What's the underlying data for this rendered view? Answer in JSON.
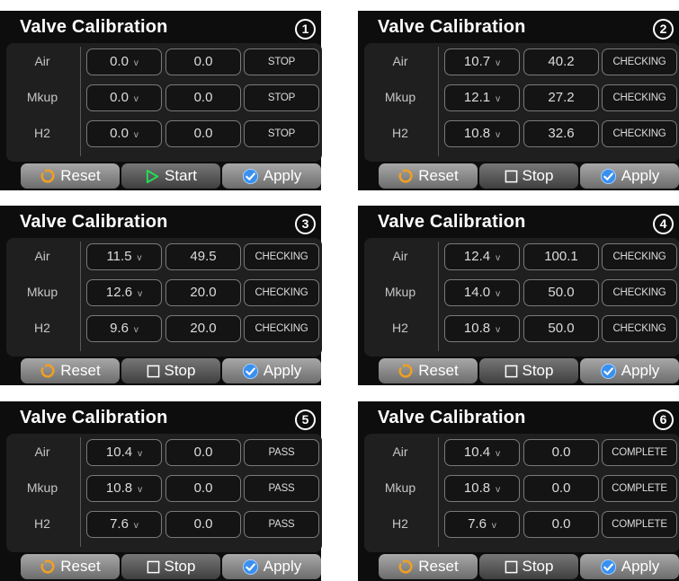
{
  "units": {
    "voltage": "v"
  },
  "icons": {
    "reset": "circular-arrow-icon",
    "start": "play-triangle-icon",
    "stop": "stop-square-icon",
    "apply": "checkmark-circle-icon"
  },
  "colors": {
    "reset_icon": "#f0a020",
    "start_icon": "#22e055",
    "apply_icon": "#3a90ee"
  },
  "row_labels": [
    "Air",
    "Mkup",
    "H2"
  ],
  "panels": [
    {
      "title": "Valve Calibration",
      "number": "1",
      "rows": [
        {
          "label": "Air",
          "voltage": "0.0",
          "value": "0.0",
          "status": "STOP"
        },
        {
          "label": "Mkup",
          "voltage": "0.0",
          "value": "0.0",
          "status": "STOP"
        },
        {
          "label": "H2",
          "voltage": "0.0",
          "value": "0.0",
          "status": "STOP"
        }
      ],
      "buttons": {
        "reset": "Reset",
        "middle": "Start",
        "apply": "Apply"
      }
    },
    {
      "title": "Valve Calibration",
      "number": "2",
      "rows": [
        {
          "label": "Air",
          "voltage": "10.7",
          "value": "40.2",
          "status": "CHECKING"
        },
        {
          "label": "Mkup",
          "voltage": "12.1",
          "value": "27.2",
          "status": "CHECKING"
        },
        {
          "label": "H2",
          "voltage": "10.8",
          "value": "32.6",
          "status": "CHECKING"
        }
      ],
      "buttons": {
        "reset": "Reset",
        "middle": "Stop",
        "apply": "Apply"
      }
    },
    {
      "title": "Valve Calibration",
      "number": "3",
      "rows": [
        {
          "label": "Air",
          "voltage": "11.5",
          "value": "49.5",
          "status": "CHECKING"
        },
        {
          "label": "Mkup",
          "voltage": "12.6",
          "value": "20.0",
          "status": "CHECKING"
        },
        {
          "label": "H2",
          "voltage": "9.6",
          "value": "20.0",
          "status": "CHECKING"
        }
      ],
      "buttons": {
        "reset": "Reset",
        "middle": "Stop",
        "apply": "Apply"
      }
    },
    {
      "title": "Valve Calibration",
      "number": "4",
      "rows": [
        {
          "label": "Air",
          "voltage": "12.4",
          "value": "100.1",
          "status": "CHECKING"
        },
        {
          "label": "Mkup",
          "voltage": "14.0",
          "value": "50.0",
          "status": "CHECKING"
        },
        {
          "label": "H2",
          "voltage": "10.8",
          "value": "50.0",
          "status": "CHECKING"
        }
      ],
      "buttons": {
        "reset": "Reset",
        "middle": "Stop",
        "apply": "Apply"
      }
    },
    {
      "title": "Valve Calibration",
      "number": "5",
      "rows": [
        {
          "label": "Air",
          "voltage": "10.4",
          "value": "0.0",
          "status": "PASS"
        },
        {
          "label": "Mkup",
          "voltage": "10.8",
          "value": "0.0",
          "status": "PASS"
        },
        {
          "label": "H2",
          "voltage": "7.6",
          "value": "0.0",
          "status": "PASS"
        }
      ],
      "buttons": {
        "reset": "Reset",
        "middle": "Stop",
        "apply": "Apply"
      }
    },
    {
      "title": "Valve Calibration",
      "number": "6",
      "rows": [
        {
          "label": "Air",
          "voltage": "10.4",
          "value": "0.0",
          "status": "COMPLETE"
        },
        {
          "label": "Mkup",
          "voltage": "10.8",
          "value": "0.0",
          "status": "COMPLETE"
        },
        {
          "label": "H2",
          "voltage": "7.6",
          "value": "0.0",
          "status": "COMPLETE"
        }
      ],
      "buttons": {
        "reset": "Reset",
        "middle": "Stop",
        "apply": "Apply"
      }
    }
  ]
}
